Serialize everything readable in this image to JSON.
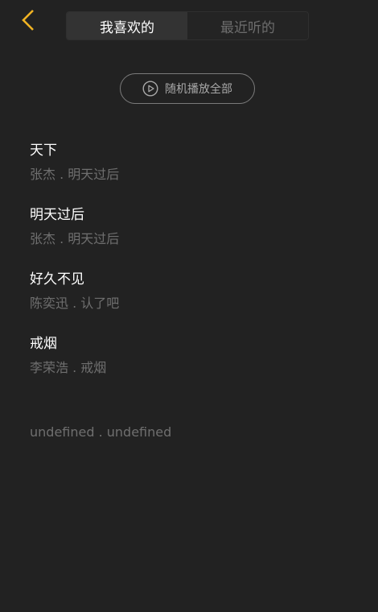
{
  "header": {
    "back_icon": "chevron-left-icon",
    "accent_color": "#f0b323",
    "tabs": [
      {
        "label": "我喜欢的",
        "active": true
      },
      {
        "label": "最近听的",
        "active": false
      }
    ]
  },
  "shuffle": {
    "icon": "play-circle-icon",
    "label": "随机播放全部"
  },
  "songs": [
    {
      "name": "天下",
      "desc": "张杰 . 明天过后"
    },
    {
      "name": "明天过后",
      "desc": "张杰 . 明天过后"
    },
    {
      "name": "好久不见",
      "desc": "陈奕迅 . 认了吧"
    },
    {
      "name": "戒烟",
      "desc": "李荣浩 . 戒烟"
    },
    {
      "name": "",
      "desc": "undefined . undefined"
    }
  ]
}
